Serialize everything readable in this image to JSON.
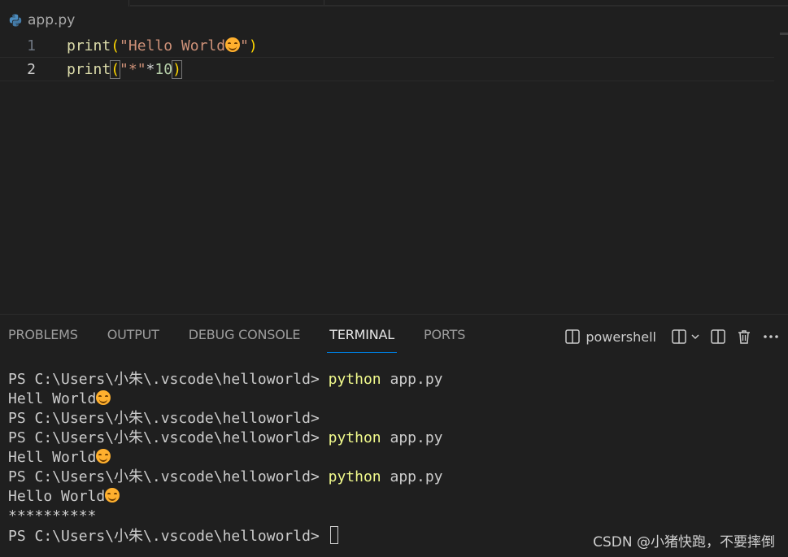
{
  "editor": {
    "file_name": "app.py",
    "lines": [
      {
        "number": "1",
        "fn": "print",
        "open": "(",
        "text": "\"Hello World",
        "emoji": "smile-emoji",
        "close_str": "\"",
        "close": ")"
      },
      {
        "number": "2",
        "fn": "print",
        "open": "(",
        "str": "\"*\"",
        "op": "*",
        "num": "10",
        "close": ")"
      }
    ]
  },
  "panel": {
    "tabs": [
      "PROBLEMS",
      "OUTPUT",
      "DEBUG CONSOLE",
      "TERMINAL",
      "PORTS"
    ],
    "active_tab": "TERMINAL",
    "shell_name": "powershell"
  },
  "terminal": {
    "prompt": "PS C:\\Users\\小朱\\.vscode\\helloworld> ",
    "prompt_no_space": "PS C:\\Users\\小朱\\.vscode\\helloworld>",
    "cmd": "python",
    "arg": " app.py",
    "out_hell": "Hell World",
    "out_hello": "Hello World",
    "stars": "**********"
  },
  "watermark": "CSDN @小猪快跑，不要摔倒",
  "colors": {
    "background": "#1f1f1f",
    "accent": "#0078d4",
    "command": "#f1fa8c"
  }
}
